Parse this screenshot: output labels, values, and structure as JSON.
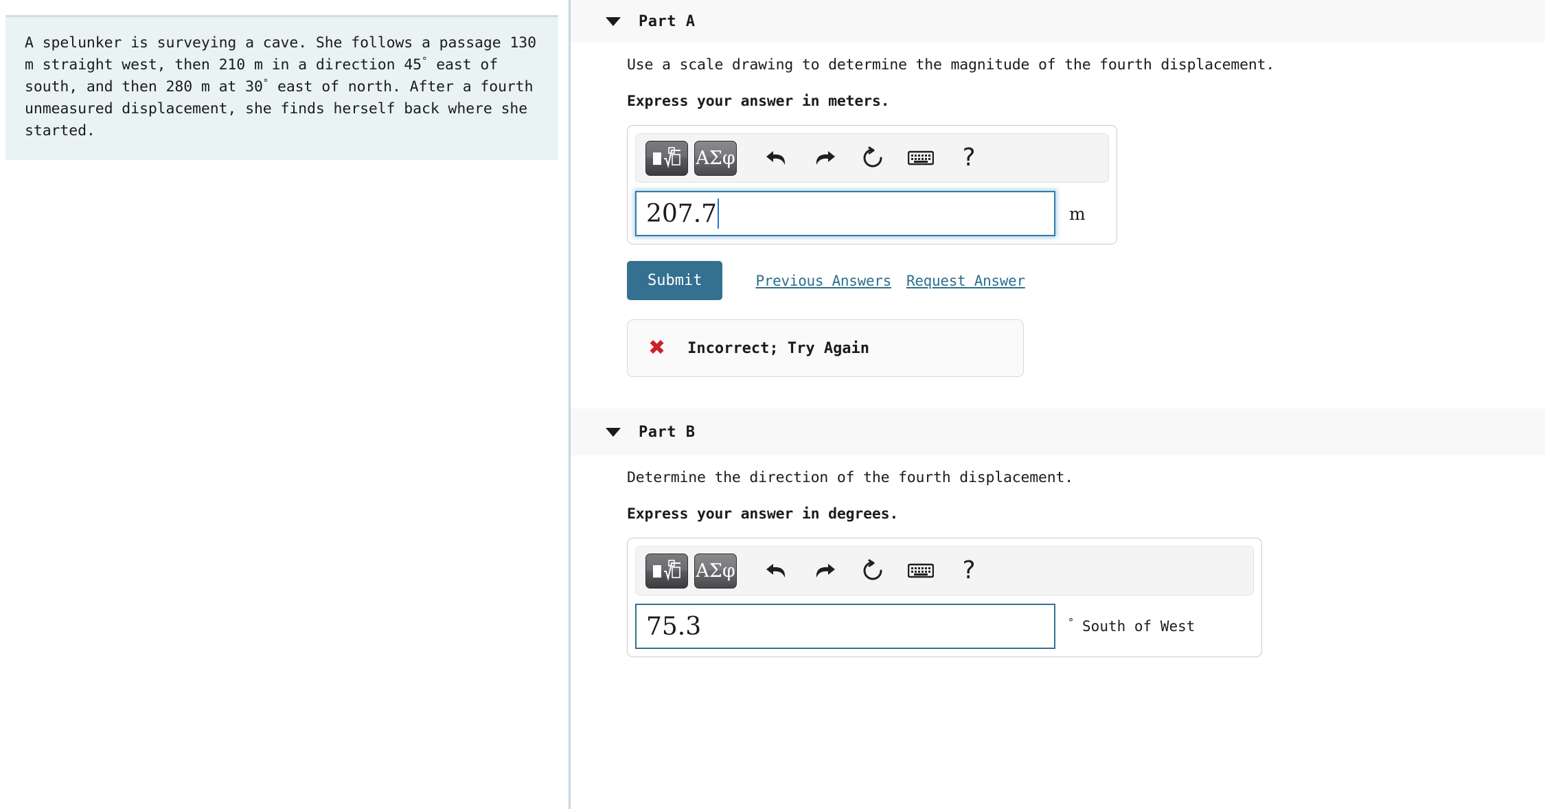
{
  "problem": {
    "text_segments": [
      "A spelunker is surveying a cave. She follows a passage 130 m straight west, then 210 m in a direction 45",
      "°",
      " east of south, and then 280 m at 30",
      "°",
      " east of north. After a fourth unmeasured displacement, she finds herself back where she started."
    ],
    "full_text": "A spelunker is surveying a cave. She follows a passage 130 m straight west, then 210 m in a direction 45° east of south, and then 280 m at 30° east of north. After a fourth unmeasured displacement, she finds herself back where she started.",
    "background_color": "#e9f3f4"
  },
  "parts": {
    "a": {
      "title": "Part A",
      "caret": "caret-down-icon",
      "question": "Use a scale drawing to determine the magnitude of the fourth displacement.",
      "instruction": "Express your answer in meters.",
      "answer_value": "207.7",
      "unit": "m",
      "submit_label": "Submit",
      "previous_answers_label": "Previous Answers",
      "request_answer_label": "Request Answer",
      "feedback": {
        "icon": "red-x-icon",
        "glyph": "✖",
        "text": "Incorrect; Try Again",
        "color": "#cc2229"
      }
    },
    "b": {
      "title": "Part B",
      "caret": "caret-down-icon",
      "question": "Determine the direction of the fourth displacement.",
      "instruction": "Express your answer in degrees.",
      "answer_value": "75.3",
      "unit_degree": "°",
      "unit_text": "South of West"
    }
  },
  "toolbar": {
    "template_button": {
      "name": "math-template-icon",
      "label": ""
    },
    "greek_button": {
      "name": "greek-symbols-icon",
      "label": "ΑΣφ"
    },
    "icons": [
      {
        "name": "undo-icon",
        "title": "Undo"
      },
      {
        "name": "redo-icon",
        "title": "Redo"
      },
      {
        "name": "reset-icon",
        "title": "Reset"
      },
      {
        "name": "keyboard-icon",
        "title": "Keyboard shortcuts"
      },
      {
        "name": "help-icon",
        "title": "Help",
        "glyph": "?"
      }
    ]
  },
  "colors": {
    "submit_blue": "#34708f",
    "link_blue": "#2c6f8e",
    "input_focus_border": "#2d7ca8",
    "problem_bg": "#e9f3f4",
    "header_bg": "#f8f8f8",
    "error_red": "#cc2229"
  }
}
